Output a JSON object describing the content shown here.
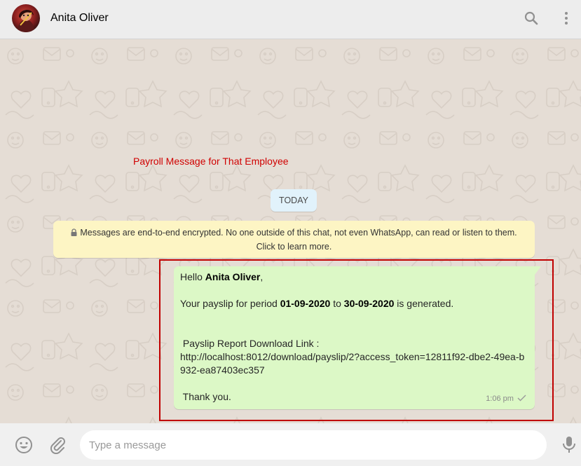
{
  "header": {
    "contact_name": "Anita Oliver",
    "icons": [
      "search-icon",
      "menu-dots-icon"
    ]
  },
  "chat": {
    "page_title": "Payroll Message for That Employee",
    "date_divider": "TODAY",
    "encryption_notice": {
      "line1": "Messages are end-to-end encrypted. No one outside of this chat, not even WhatsApp, can read or listen to them.",
      "line2": "Click to learn more."
    },
    "message": {
      "greeting_prefix": "Hello ",
      "recipient_name": "Anita Oliver",
      "greeting_suffix": ",",
      "period_prefix": "Your payslip for period ",
      "period_start": "01-09-2020",
      "period_middle": " to ",
      "period_end": "30-09-2020",
      "period_suffix": " is generated.",
      "link_label": " Payslip Report Download Link :",
      "link_url": "http://localhost:8012/download/payslip/2?access_token=12811f92-dbe2-49ea-b932-ea87403ec357",
      "closing": " Thank you.",
      "time": "1:06 pm",
      "status_icon": "single-check-icon"
    }
  },
  "composer": {
    "placeholder": "Type a message",
    "icons": [
      "emoji-icon",
      "attach-icon",
      "microphone-icon"
    ]
  },
  "colors": {
    "header_bg": "#ededed",
    "chat_bg": "#e5ddd5",
    "outgoing_bubble": "#dcf8c6",
    "date_chip": "#e1f2fb",
    "encryption_notice_bg": "#fdf5c4",
    "title_red": "#d00000",
    "highlight_border": "#c00000"
  }
}
